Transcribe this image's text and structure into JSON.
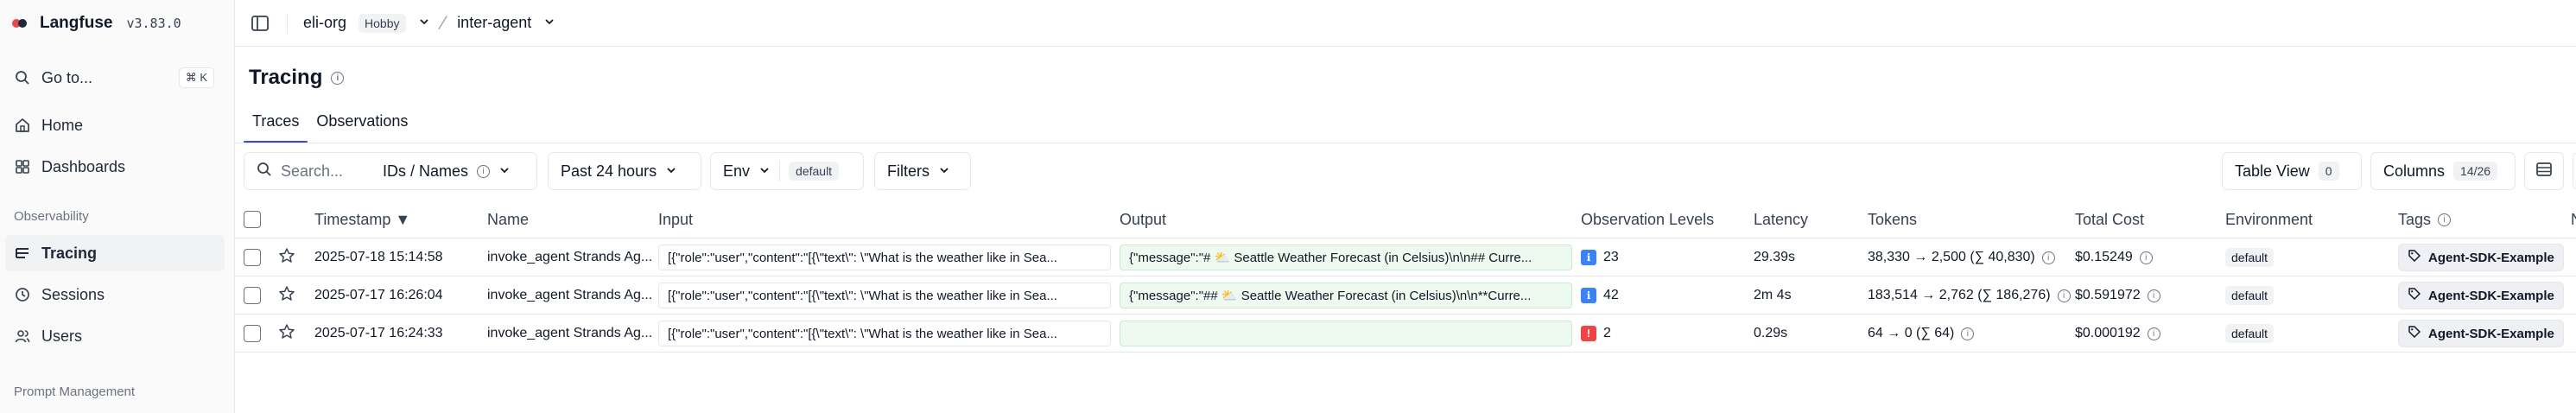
{
  "brand": {
    "name": "Langfuse",
    "version": "v3.83.0"
  },
  "sidebar": {
    "goto": {
      "label": "Go to...",
      "shortcut": "⌘ K"
    },
    "items_top": [
      {
        "label": "Home",
        "icon": "home-icon"
      },
      {
        "label": "Dashboards",
        "icon": "dashboard-icon"
      }
    ],
    "section_observability": "Observability",
    "items_obs": [
      {
        "label": "Tracing",
        "icon": "tracing-icon",
        "active": true
      },
      {
        "label": "Sessions",
        "icon": "sessions-icon"
      },
      {
        "label": "Users",
        "icon": "users-icon"
      }
    ],
    "section_prompt": "Prompt Management"
  },
  "topbar": {
    "org": "eli-org",
    "plan": "Hobby",
    "project": "inter-agent"
  },
  "page": {
    "title": "Tracing"
  },
  "tabs": [
    {
      "label": "Traces",
      "active": true
    },
    {
      "label": "Observations",
      "active": false
    }
  ],
  "filters": {
    "search_placeholder": "Search...",
    "search_mode": "IDs / Names",
    "time_range": "Past 24 hours",
    "env_label": "Env",
    "env_value": "default",
    "filters_label": "Filters",
    "table_view_label": "Table View",
    "table_view_count": "0",
    "columns_label": "Columns",
    "columns_count": "14/26"
  },
  "table": {
    "headers": {
      "timestamp": "Timestamp ▼",
      "name": "Name",
      "input": "Input",
      "output": "Output",
      "levels": "Observation Levels",
      "latency": "Latency",
      "tokens": "Tokens",
      "cost": "Total Cost",
      "environment": "Environment",
      "tags": "Tags",
      "extra": "N"
    },
    "rows": [
      {
        "timestamp": "2025-07-18 15:14:58",
        "name": "invoke_agent Strands Ag...",
        "input": "[{\"role\":\"user\",\"content\":\"[{\\\"text\\\": \\\"What is the weather like in Sea...",
        "output": "{\"message\":\"# ⛅ Seattle Weather Forecast (in Celsius)\\n\\n## Curre...",
        "level_icon": "ℹ",
        "level_color": "#3b82f6",
        "level_count": "23",
        "latency": "29.39s",
        "tokens": "38,330 → 2,500 (∑ 40,830)",
        "cost": "$0.15249",
        "environment": "default",
        "tag": "Agent-SDK-Example"
      },
      {
        "timestamp": "2025-07-17 16:26:04",
        "name": "invoke_agent Strands Ag...",
        "input": "[{\"role\":\"user\",\"content\":\"[{\\\"text\\\": \\\"What is the weather like in Sea...",
        "output": "{\"message\":\"## ⛅ Seattle Weather Forecast (in Celsius)\\n\\n**Curre...",
        "level_icon": "ℹ",
        "level_color": "#3b82f6",
        "level_count": "42",
        "latency": "2m 4s",
        "tokens": "183,514 → 2,762 (∑ 186,276)",
        "cost": "$0.591972",
        "environment": "default",
        "tag": "Agent-SDK-Example"
      },
      {
        "timestamp": "2025-07-17 16:24:33",
        "name": "invoke_agent Strands Ag...",
        "input": "[{\"role\":\"user\",\"content\":\"[{\\\"text\\\": \\\"What is the weather like in Sea...",
        "output": "",
        "level_icon": "!",
        "level_color": "#ef4444",
        "level_count": "2",
        "latency": "0.29s",
        "tokens": "64 → 0 (∑ 64)",
        "cost": "$0.000192",
        "environment": "default",
        "tag": "Agent-SDK-Example"
      }
    ]
  }
}
